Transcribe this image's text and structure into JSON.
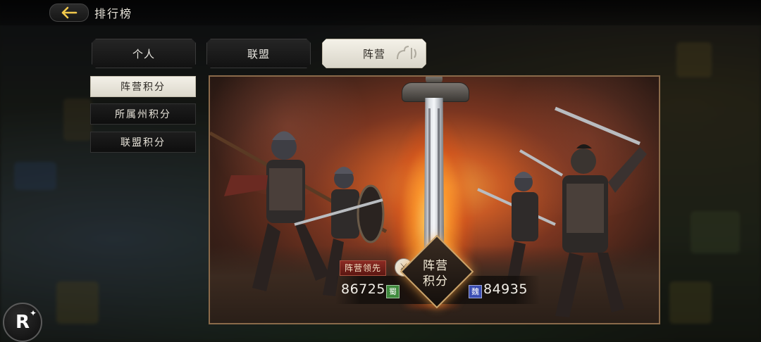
{
  "header": {
    "title": "排行榜"
  },
  "tabs": [
    {
      "label": "个人",
      "active": false
    },
    {
      "label": "联盟",
      "active": false
    },
    {
      "label": "阵营",
      "active": true
    }
  ],
  "sub_tabs": [
    {
      "label": "阵营积分",
      "active": true
    },
    {
      "label": "所属州积分",
      "active": false
    },
    {
      "label": "联盟积分",
      "active": false
    }
  ],
  "camp_score": {
    "center_label_line1": "阵营",
    "center_label_line2": "积分",
    "lead_badge": "阵营领先",
    "left": {
      "score": "86725",
      "faction": "蜀",
      "color": "#3f8a3d"
    },
    "right": {
      "score": "84935",
      "faction": "魏",
      "color": "#3c4fb3"
    }
  },
  "floating_button": {
    "label": "R",
    "icon": "sparkle-icon"
  },
  "colors": {
    "accent_gold": "#c9a36a",
    "badge_red": "#8b2a22",
    "shu_green": "#3f8a3d",
    "wei_blue": "#3c4fb3"
  }
}
